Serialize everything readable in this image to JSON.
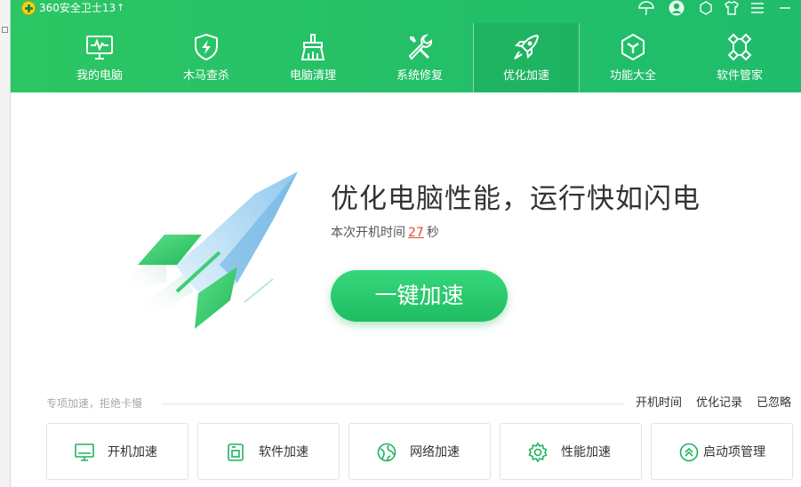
{
  "window": {
    "title": "360安全卫士13"
  },
  "nav": {
    "items": [
      {
        "label": "我的电脑",
        "icon": "monitor-pulse-icon",
        "active": false
      },
      {
        "label": "木马查杀",
        "icon": "shield-bolt-icon",
        "active": false
      },
      {
        "label": "电脑清理",
        "icon": "broom-icon",
        "active": false
      },
      {
        "label": "系统修复",
        "icon": "wrench-icon",
        "active": false
      },
      {
        "label": "优化加速",
        "icon": "rocket-icon",
        "active": true
      },
      {
        "label": "功能大全",
        "icon": "cube-icon",
        "active": false
      },
      {
        "label": "软件管家",
        "icon": "apps-grid-icon",
        "active": false
      }
    ]
  },
  "hero": {
    "headline": "优化电脑性能，运行快如闪电",
    "boot_prefix": "本次开机时间",
    "boot_seconds": "27",
    "boot_unit": "秒",
    "button_label": "一键加速"
  },
  "section": {
    "title": "专项加速，拒绝卡慢",
    "links": [
      "开机时间",
      "优化记录",
      "已忽略"
    ]
  },
  "cards": [
    {
      "label": "开机加速",
      "icon": "monitor-icon"
    },
    {
      "label": "软件加速",
      "icon": "app-window-icon"
    },
    {
      "label": "网络加速",
      "icon": "globe-icon"
    },
    {
      "label": "性能加速",
      "icon": "gear-icon"
    },
    {
      "label": "启动项管理",
      "icon": "double-chevron-up-icon"
    }
  ],
  "colors": {
    "header_green": "#23bf68",
    "button_green": "#1fbd62",
    "boot_number": "#e04a2a"
  }
}
